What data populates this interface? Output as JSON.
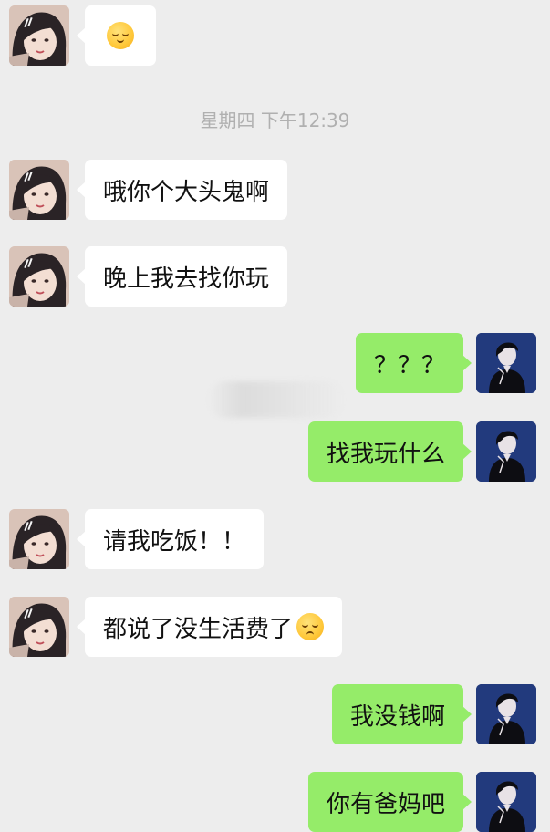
{
  "timestamp": "星期四 下午12:39",
  "messages": [
    {
      "side": "left",
      "text": "",
      "emoji": "relieved-face"
    },
    {
      "side": "left",
      "text": "哦你个大头鬼啊"
    },
    {
      "side": "left",
      "text": "晚上我去找你玩"
    },
    {
      "side": "right",
      "text": "？？？"
    },
    {
      "side": "right",
      "text": "找我玩什么"
    },
    {
      "side": "left",
      "text": "请我吃饭！！"
    },
    {
      "side": "left",
      "text": "都说了没生活费了",
      "emoji": "pensive-face"
    },
    {
      "side": "right",
      "text": "我没钱啊"
    },
    {
      "side": "right",
      "text": "你有爸妈吧"
    }
  ],
  "colors": {
    "background": "#ededed",
    "incoming_bubble": "#ffffff",
    "outgoing_bubble": "#95ec69",
    "timestamp_text": "#b0b0b0"
  }
}
